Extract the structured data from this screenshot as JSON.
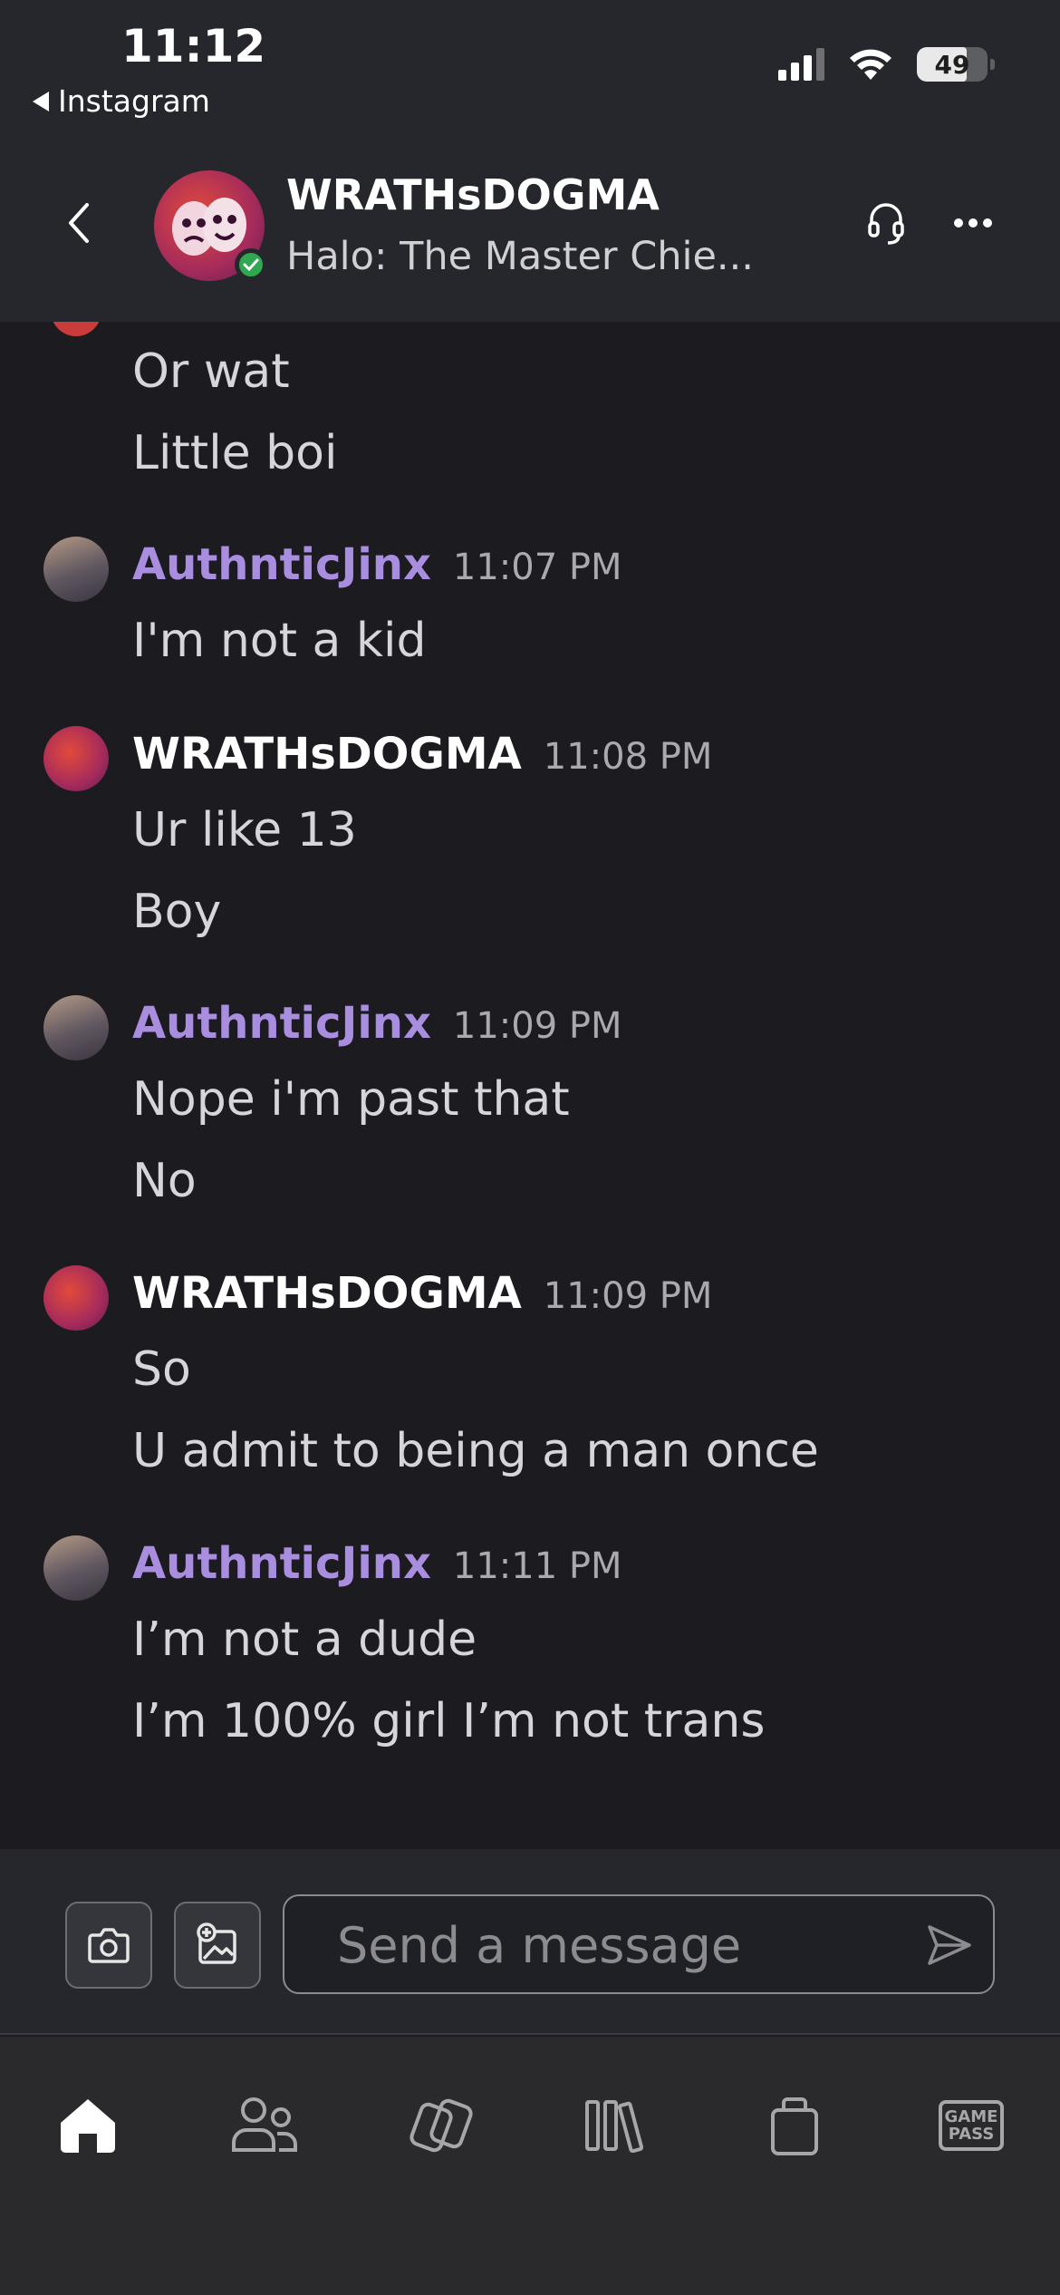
{
  "status_bar": {
    "time": "11:12",
    "back_app": "Instagram",
    "battery": "49"
  },
  "chat_header": {
    "title": "WRATHsDOGMA",
    "subtitle": "Halo: The Master Chie..."
  },
  "messages": {
    "continued_lines": [
      "Or wat",
      "Little boi"
    ],
    "groups": [
      {
        "author": "AuthnticJinx",
        "time": "11:07 PM",
        "lines": [
          "I'm not a kid"
        ]
      },
      {
        "author": "WRATHsDOGMA",
        "time": "11:08 PM",
        "lines": [
          "Ur like 13",
          "Boy"
        ]
      },
      {
        "author": "AuthnticJinx",
        "time": "11:09 PM",
        "lines": [
          "Nope i'm past that",
          "No"
        ]
      },
      {
        "author": "WRATHsDOGMA",
        "time": "11:09 PM",
        "lines": [
          "So",
          "U admit to being a man once"
        ]
      },
      {
        "author": "AuthnticJinx",
        "time": "11:11 PM",
        "lines": [
          "I’m not a dude",
          "I’m 100% girl I’m not trans"
        ]
      }
    ]
  },
  "composer": {
    "placeholder": "Send a message"
  },
  "tabbar": {
    "gamepass_line1": "GAME",
    "gamepass_line2": "PASS"
  },
  "colors": {
    "header_bg": "#26272c",
    "chat_bg": "#1b1b20",
    "jinx_name": "#a98ee0",
    "presence": "#2fa84f"
  }
}
